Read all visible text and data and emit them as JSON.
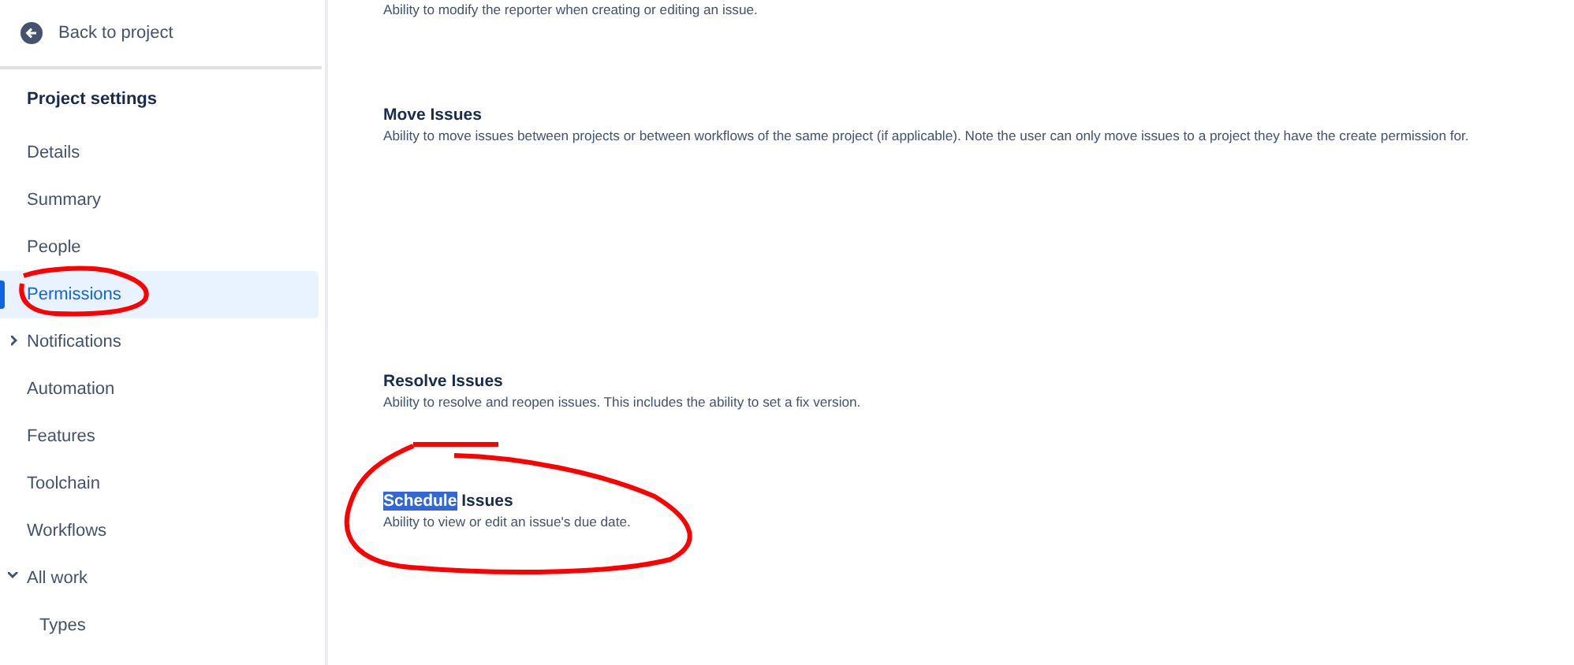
{
  "sidebar": {
    "back_link": "Back to project",
    "heading": "Project settings",
    "items": [
      {
        "label": "Details",
        "selected": false
      },
      {
        "label": "Summary",
        "selected": false
      },
      {
        "label": "People",
        "selected": false
      },
      {
        "label": "Permissions",
        "selected": true
      },
      {
        "label": "Notifications",
        "selected": false,
        "expanded": false
      },
      {
        "label": "Automation",
        "selected": false
      },
      {
        "label": "Features",
        "selected": false
      },
      {
        "label": "Toolchain",
        "selected": false
      },
      {
        "label": "Workflows",
        "selected": false
      },
      {
        "label": "All work",
        "selected": false,
        "expanded": true,
        "children": [
          {
            "label": "Types",
            "selected": false
          }
        ]
      }
    ]
  },
  "permissions": [
    {
      "description": "Ability to modify the reporter when creating or editing an issue."
    },
    {
      "title_parts": [
        {
          "text": "Move Issues",
          "selected": false
        }
      ],
      "description": "Ability to move issues between projects or between workflows of the same project (if applicable). Note the user can only move issues to a project they have the create permission for."
    },
    {
      "title_parts": [
        {
          "text": "Resolve Issues",
          "selected": false
        }
      ],
      "description": "Ability to resolve and reopen issues. This includes the ability to set a fix version."
    },
    {
      "title_parts": [
        {
          "text": "Schedule",
          "selected": true
        },
        {
          "text": "Issues",
          "selected": false
        }
      ],
      "description": "Ability to view or edit an issue's due date."
    }
  ]
}
